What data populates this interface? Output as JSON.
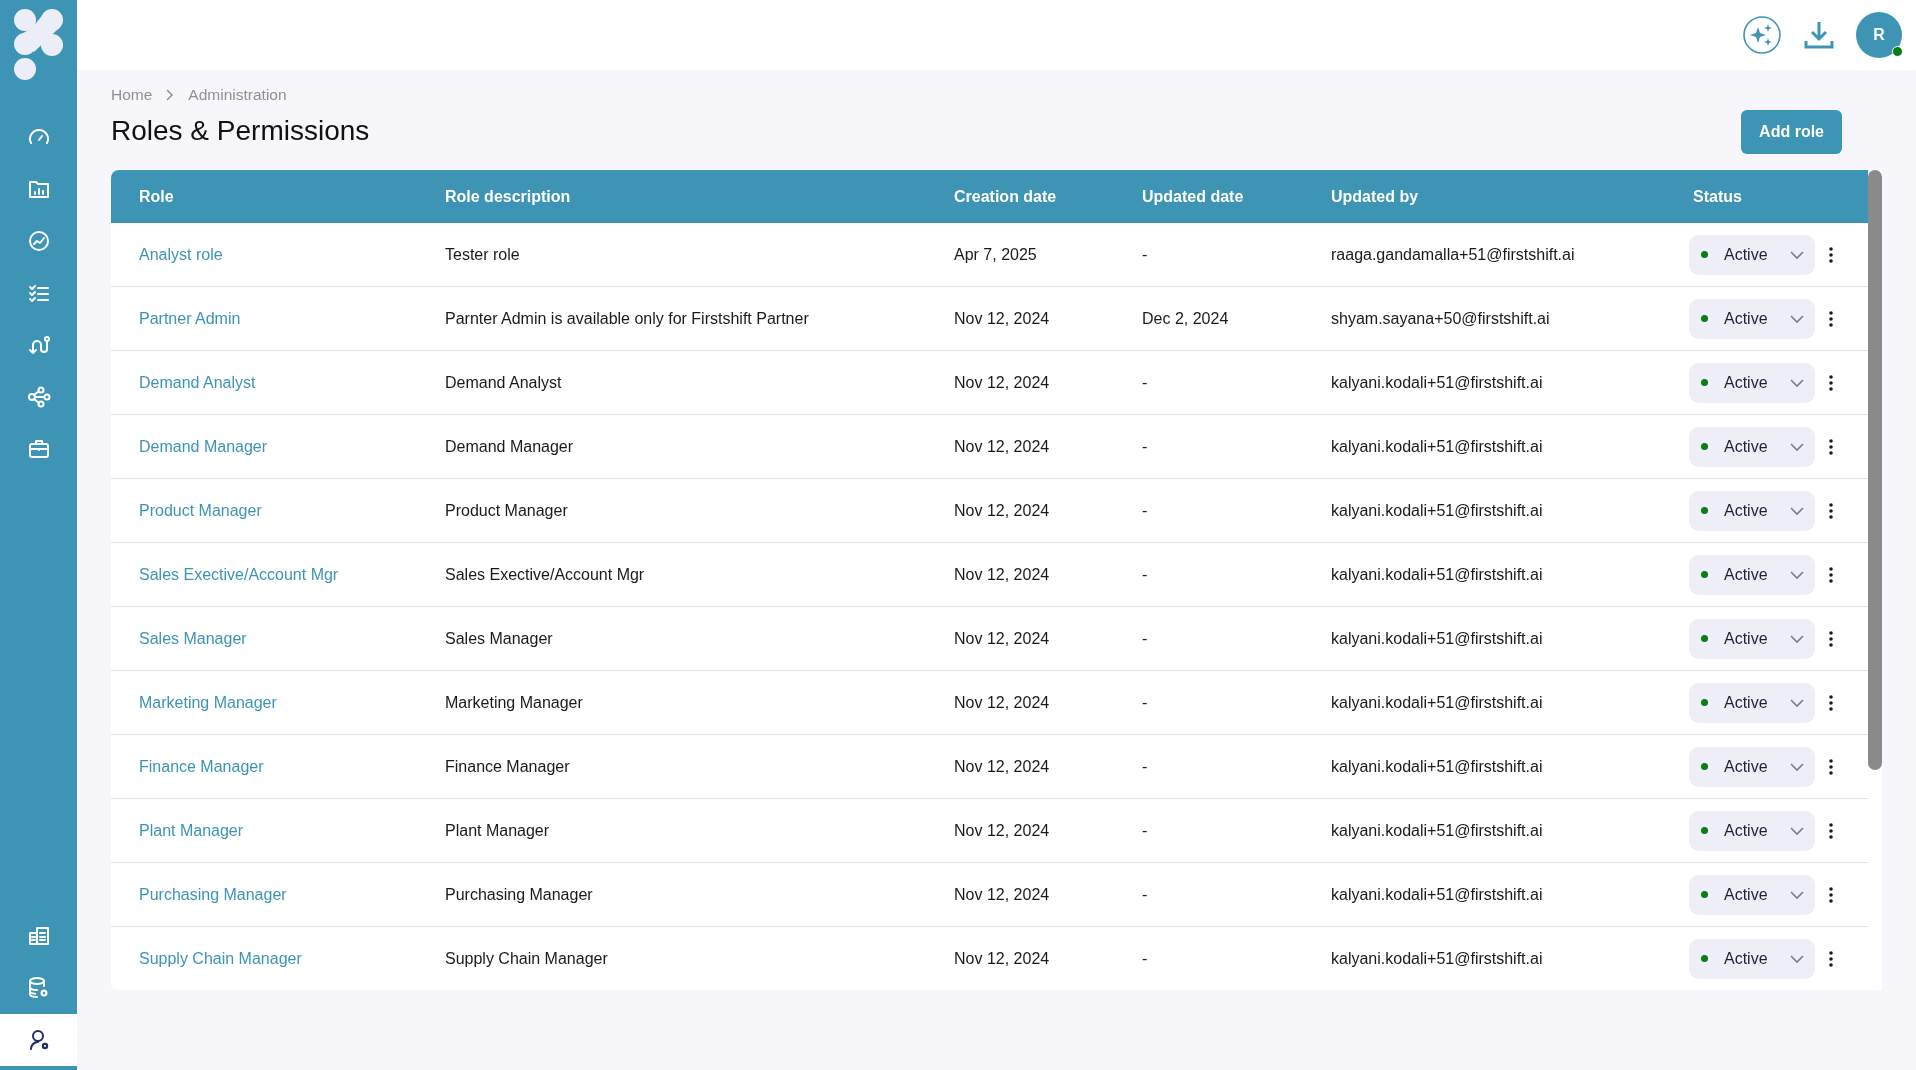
{
  "sidebar": {
    "top_items": [
      {
        "selected": false
      },
      {
        "selected": false
      },
      {
        "selected": false
      },
      {
        "selected": false
      },
      {
        "selected": false
      },
      {
        "selected": false
      },
      {
        "selected": false
      }
    ],
    "bottom_items": [
      {
        "selected": false
      },
      {
        "selected": false
      },
      {
        "selected": true
      }
    ]
  },
  "top_bar": {
    "avatar": {
      "initial": "R",
      "online": true
    }
  },
  "breadcrumb": [
    "Home",
    "Administration"
  ],
  "page_title": "Roles & Permissions",
  "add_button": "Add role",
  "table": {
    "columns": [
      "Role",
      "Role description",
      "Creation date",
      "Updated date",
      "Updated by",
      "Status"
    ],
    "rows": [
      {
        "role": "Analyst role",
        "description": "Tester role",
        "created": "Apr 7, 2025",
        "updated": "-",
        "updated_by": "raaga.gandamalla+51@firstshift.ai",
        "status": "Active"
      },
      {
        "role": "Partner Admin",
        "description": "Parnter Admin is available only for Firstshift Partner",
        "created": "Nov 12, 2024",
        "updated": "Dec 2, 2024",
        "updated_by": "shyam.sayana+50@firstshift.ai",
        "status": "Active"
      },
      {
        "role": "Demand Analyst",
        "description": "Demand Analyst",
        "created": "Nov 12, 2024",
        "updated": "-",
        "updated_by": "kalyani.kodali+51@firstshift.ai",
        "status": "Active"
      },
      {
        "role": "Demand Manager",
        "description": "Demand Manager",
        "created": "Nov 12, 2024",
        "updated": "-",
        "updated_by": "kalyani.kodali+51@firstshift.ai",
        "status": "Active"
      },
      {
        "role": "Product Manager",
        "description": "Product Manager",
        "created": "Nov 12, 2024",
        "updated": "-",
        "updated_by": "kalyani.kodali+51@firstshift.ai",
        "status": "Active"
      },
      {
        "role": "Sales Exective/Account Mgr",
        "description": "Sales Exective/Account Mgr",
        "created": "Nov 12, 2024",
        "updated": "-",
        "updated_by": "kalyani.kodali+51@firstshift.ai",
        "status": "Active"
      },
      {
        "role": "Sales Manager",
        "description": "Sales Manager",
        "created": "Nov 12, 2024",
        "updated": "-",
        "updated_by": "kalyani.kodali+51@firstshift.ai",
        "status": "Active"
      },
      {
        "role": "Marketing Manager",
        "description": "Marketing Manager",
        "created": "Nov 12, 2024",
        "updated": "-",
        "updated_by": "kalyani.kodali+51@firstshift.ai",
        "status": "Active"
      },
      {
        "role": "Finance Manager",
        "description": "Finance Manager",
        "created": "Nov 12, 2024",
        "updated": "-",
        "updated_by": "kalyani.kodali+51@firstshift.ai",
        "status": "Active"
      },
      {
        "role": "Plant Manager",
        "description": "Plant Manager",
        "created": "Nov 12, 2024",
        "updated": "-",
        "updated_by": "kalyani.kodali+51@firstshift.ai",
        "status": "Active"
      },
      {
        "role": "Purchasing Manager",
        "description": "Purchasing Manager",
        "created": "Nov 12, 2024",
        "updated": "-",
        "updated_by": "kalyani.kodali+51@firstshift.ai",
        "status": "Active"
      },
      {
        "role": "Supply Chain Manager",
        "description": "Supply Chain Manager",
        "created": "Nov 12, 2024",
        "updated": "-",
        "updated_by": "kalyani.kodali+51@firstshift.ai",
        "status": "Active"
      }
    ]
  }
}
